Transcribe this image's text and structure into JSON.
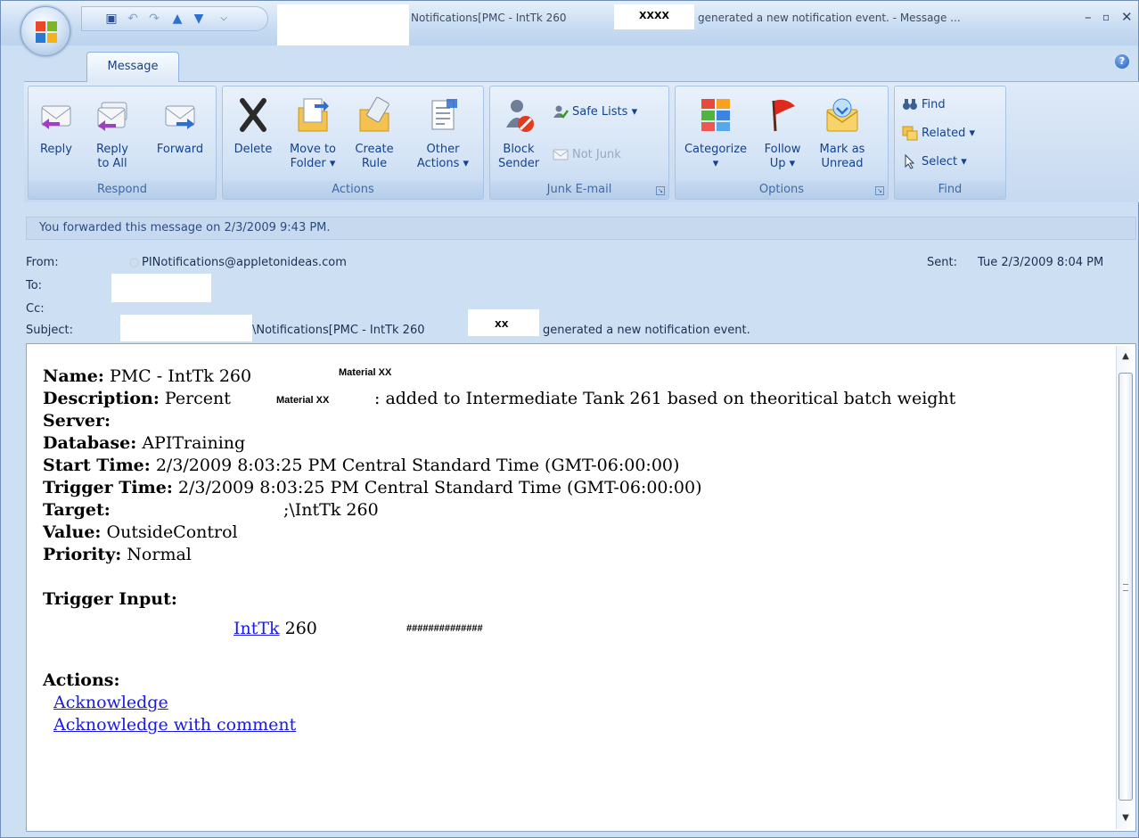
{
  "title_bar": {
    "prefix": "Notifications[PMC - IntTk 260",
    "redacted_mark": "XXXX",
    "suffix": "generated a new notification event. - Message ..."
  },
  "tabs": [
    {
      "label": "Message"
    }
  ],
  "ribbon": {
    "respond": {
      "label": "Respond",
      "reply": "Reply",
      "reply_all_1": "Reply",
      "reply_all_2": "to All",
      "forward": "Forward"
    },
    "actions": {
      "label": "Actions",
      "delete": "Delete",
      "move_1": "Move to",
      "move_2": "Folder",
      "create_1": "Create",
      "create_2": "Rule",
      "other_1": "Other",
      "other_2": "Actions"
    },
    "junk": {
      "label": "Junk E-mail",
      "block_1": "Block",
      "block_2": "Sender",
      "safe_lists": "Safe Lists",
      "not_junk": "Not Junk"
    },
    "options": {
      "label": "Options",
      "categorize": "Categorize",
      "follow_1": "Follow",
      "follow_2": "Up",
      "mark_1": "Mark as",
      "mark_2": "Unread"
    },
    "find": {
      "label": "Find",
      "find": "Find",
      "related": "Related",
      "select": "Select"
    }
  },
  "info_bar": "You forwarded this message on 2/3/2009 9:43 PM.",
  "header": {
    "from_label": "From:",
    "from_value": "PINotifications@appletonideas.com",
    "sent_label": "Sent:",
    "sent_value": "Tue 2/3/2009 8:04 PM",
    "to_label": "To:",
    "cc_label": "Cc:",
    "subject_label": "Subject:",
    "subject_prefix": "\\Notifications[PMC - IntTk 260",
    "subject_mark": "XX",
    "subject_suffix": "generated a new notification event."
  },
  "body": {
    "name_label": "Name:",
    "name_value": "PMC - IntTk 260",
    "name_mark": "Material XX",
    "desc_label": "Description:",
    "desc_value": "Percent",
    "desc_mark": "Material XX",
    "desc_rest": ": added to Intermediate Tank 261 based on theoritical batch weight",
    "server_label": "Server:",
    "db_label": "Database:",
    "db_value": "APITraining",
    "start_label": "Start Time:",
    "start_value": "2/3/2009 8:03:25 PM Central Standard Time (GMT-06:00:00)",
    "trigger_label": "Trigger Time:",
    "trigger_value": "2/3/2009 8:03:25 PM Central Standard Time (GMT-06:00:00)",
    "target_label": "Target:",
    "target_value": ";\\IntTk 260",
    "value_label": "Value:",
    "value_value": "OutsideControl",
    "priority_label": "Priority:",
    "priority_value": "Normal",
    "trigger_input_label": "Trigger Input:",
    "trigger_input_link": "IntTk",
    "trigger_input_rest": "260",
    "trigger_input_hash": "##############",
    "actions_label": "Actions:",
    "ack": "Acknowledge",
    "ack_comment": "Acknowledge with comment"
  }
}
